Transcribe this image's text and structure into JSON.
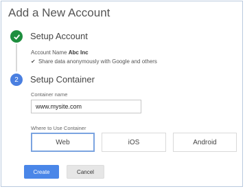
{
  "title": "Add a New Account",
  "steps": [
    {
      "number": "1",
      "title": "Setup Account",
      "state": "complete"
    },
    {
      "number": "2",
      "title": "Setup Container",
      "state": "active"
    }
  ],
  "account": {
    "name_label": "Account Name",
    "name_value": "Abc Inc",
    "share_text": "Share data anonymously with Google and others"
  },
  "container": {
    "name_label": "Container name",
    "name_value": "www.mysite.com",
    "where_label": "Where to Use Container",
    "platforms": [
      "Web",
      "iOS",
      "Android"
    ],
    "selected_platform": "Web"
  },
  "buttons": {
    "create": "Create",
    "cancel": "Cancel"
  },
  "colors": {
    "complete": "#1e8e3e",
    "active_step": "#4a7fe0",
    "primary_button": "#4a86e8",
    "selected_border": "#7aa3e0"
  },
  "icons": {
    "step1": "check-icon",
    "share": "check-icon"
  }
}
